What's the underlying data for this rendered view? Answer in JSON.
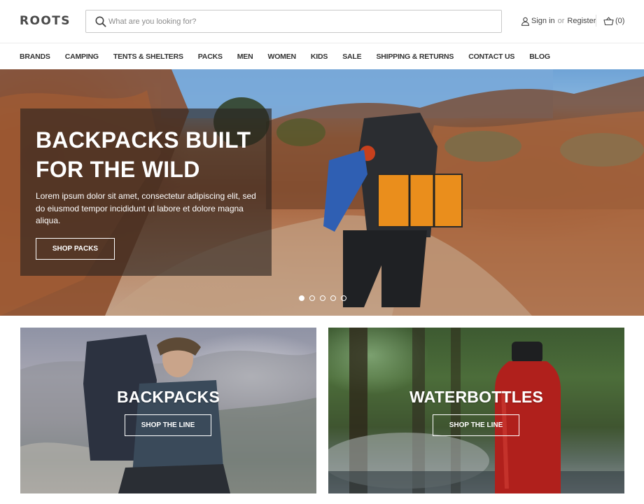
{
  "brand": {
    "logo": "ROOTS"
  },
  "search": {
    "placeholder": "What are you looking for?",
    "icon": "search-icon"
  },
  "account": {
    "sign_in": "Sign in",
    "or": "or",
    "register": "Register",
    "icon": "user-icon"
  },
  "cart": {
    "count_label": "(0)",
    "icon": "cart-icon"
  },
  "nav": {
    "items": [
      {
        "label": "BRANDS"
      },
      {
        "label": "CAMPING"
      },
      {
        "label": "TENTS & SHELTERS"
      },
      {
        "label": "PACKS"
      },
      {
        "label": "MEN"
      },
      {
        "label": "WOMEN"
      },
      {
        "label": "KIDS"
      },
      {
        "label": "SALE"
      },
      {
        "label": "SHIPPING & RETURNS"
      },
      {
        "label": "CONTACT US"
      },
      {
        "label": "BLOG"
      }
    ]
  },
  "hero": {
    "title": "BACKPACKS BUILT FOR THE WILD",
    "text": "Lorem ipsum dolor sit amet, consectetur adipiscing elit, sed do eiusmod tempor incididunt ut labore et dolore magna aliqua.",
    "button": "SHOP PACKS",
    "slides": {
      "total": 5,
      "active": 1
    }
  },
  "tiles": [
    {
      "title": "BACKPACKS",
      "button": "SHOP THE LINE"
    },
    {
      "title": "WATERBOTTLES",
      "button": "SHOP THE LINE"
    }
  ],
  "colors": {
    "text": "#333333",
    "overlay": "#28221e",
    "white": "#ffffff"
  }
}
